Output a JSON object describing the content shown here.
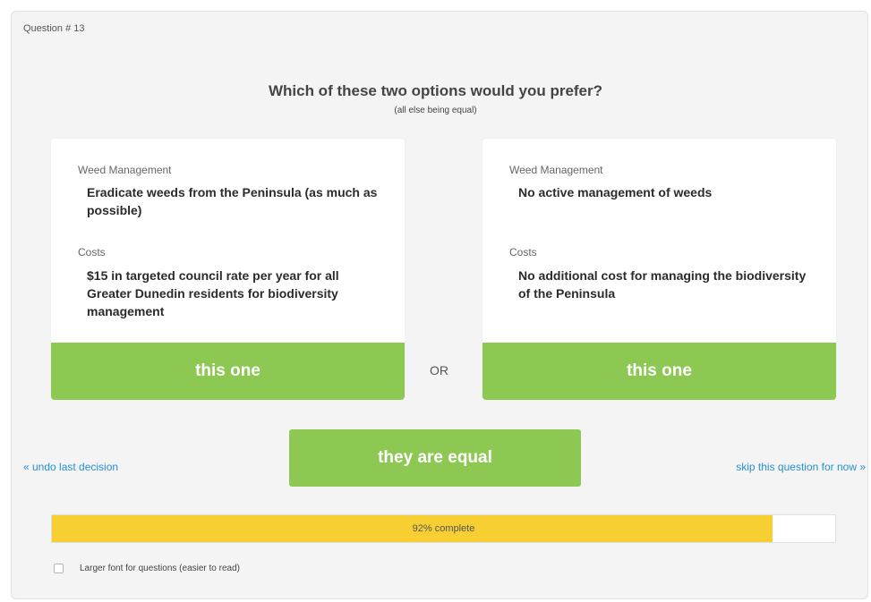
{
  "question": {
    "number_label": "Question # 13"
  },
  "prompt": {
    "title": "Which of these two options would you prefer?",
    "subtitle": "(all else being equal)"
  },
  "options": [
    {
      "attributes": [
        {
          "label": "Weed Management",
          "value": "Eradicate weeds from the Peninsula (as much as possible)"
        },
        {
          "label": "Costs",
          "value": "$15 in targeted council rate per year for all Greater Dunedin residents for biodiversity management"
        }
      ],
      "button_label": "this one"
    },
    {
      "attributes": [
        {
          "label": "Weed Management",
          "value": "No active management of weeds"
        },
        {
          "label": "Costs",
          "value": "No additional cost for managing the biodiversity of the Peninsula"
        }
      ],
      "button_label": "this one"
    }
  ],
  "or_label": "OR",
  "equal_button_label": "they are equal",
  "undo_link": "« undo last decision",
  "skip_link": "skip this question for now »",
  "progress": {
    "label": "92% complete",
    "fraction": 0.92
  },
  "font_option": {
    "label": "Larger font for questions (easier to read)",
    "checked": false
  },
  "colors": {
    "accent_green": "#8dc852",
    "progress_yellow": "#f7cf33",
    "link_blue": "#2a8fd0"
  }
}
